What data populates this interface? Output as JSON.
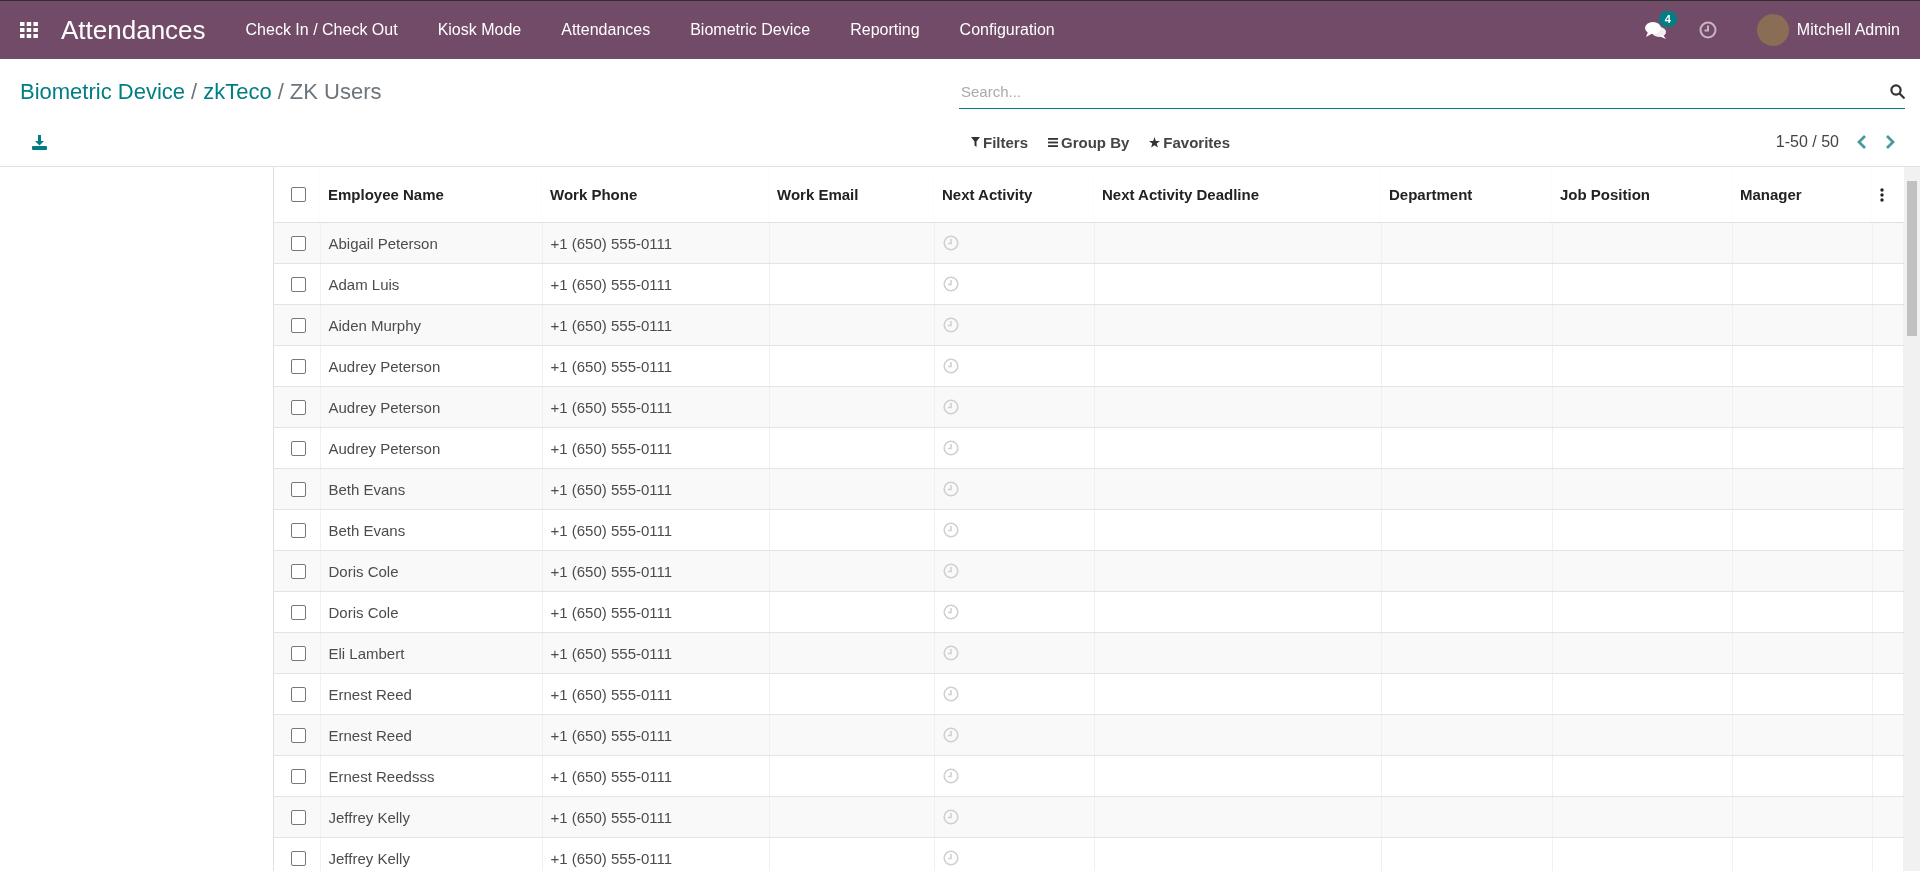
{
  "navbar": {
    "app_title": "Attendances",
    "menu": [
      "Check In / Check Out",
      "Kiosk Mode",
      "Attendances",
      "Biometric Device",
      "Reporting",
      "Configuration"
    ],
    "messages_badge": "4",
    "user_name": "Mitchell Admin"
  },
  "breadcrumb": {
    "links": [
      {
        "label": "Biometric Device",
        "separator": "/"
      },
      {
        "label": "zkTeco",
        "separator": "/"
      }
    ],
    "current": "ZK Users"
  },
  "search": {
    "placeholder": "Search..."
  },
  "filters": [
    "Filters",
    "Group By",
    "Favorites"
  ],
  "pager": "1-50 / 50",
  "table": {
    "select_all_checked": false,
    "columns": [
      "Employee Name",
      "Work Phone",
      "Work Email",
      "Next Activity",
      "Next Activity Deadline",
      "Department",
      "Job Position",
      "Manager"
    ],
    "rows": [
      {
        "checked": false,
        "name": "Abigail Peterson",
        "phone": "+1 (650) 555-0111"
      },
      {
        "checked": false,
        "name": "Adam Luis",
        "phone": "+1 (650) 555-0111"
      },
      {
        "checked": false,
        "name": "Aiden Murphy",
        "phone": "+1 (650) 555-0111"
      },
      {
        "checked": false,
        "name": "Audrey Peterson",
        "phone": "+1 (650) 555-0111"
      },
      {
        "checked": false,
        "name": "Audrey Peterson",
        "phone": "+1 (650) 555-0111"
      },
      {
        "checked": false,
        "name": "Audrey Peterson",
        "phone": "+1 (650) 555-0111"
      },
      {
        "checked": false,
        "name": "Beth Evans",
        "phone": "+1 (650) 555-0111"
      },
      {
        "checked": false,
        "name": "Beth Evans",
        "phone": "+1 (650) 555-0111"
      },
      {
        "checked": false,
        "name": "Doris Cole",
        "phone": "+1 (650) 555-0111"
      },
      {
        "checked": false,
        "name": "Doris Cole",
        "phone": "+1 (650) 555-0111"
      },
      {
        "checked": false,
        "name": "Eli Lambert",
        "phone": "+1 (650) 555-0111"
      },
      {
        "checked": false,
        "name": "Ernest Reed",
        "phone": "+1 (650) 555-0111"
      },
      {
        "checked": false,
        "name": "Ernest Reed",
        "phone": "+1 (650) 555-0111"
      },
      {
        "checked": false,
        "name": "Ernest Reedsss",
        "phone": "+1 (650) 555-0111"
      },
      {
        "checked": false,
        "name": "Jeffrey Kelly",
        "phone": "+1 (650) 555-0111"
      },
      {
        "checked": false,
        "name": "Jeffrey Kelly",
        "phone": "+1 (650) 555-0111"
      }
    ]
  }
}
